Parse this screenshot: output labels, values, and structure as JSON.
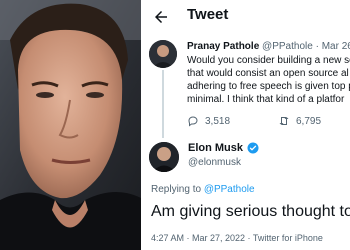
{
  "header": {
    "title": "Tweet"
  },
  "reply_tweet": {
    "author_name": "Pranay Pathole",
    "author_handle": "@PPathole",
    "separator": "·",
    "date": "Mar 26",
    "body_lines": [
      "Would you consider building a new so",
      "that would consist an open source al",
      "adhering to free speech is given top p",
      "minimal. I think that kind of a platfor"
    ],
    "stats": {
      "replies": "3,518",
      "retweets": "6,795"
    }
  },
  "main_tweet": {
    "author_name": "Elon Musk",
    "author_handle": "@elonmusk",
    "replying_prefix": "Replying to",
    "replying_handle": "@PPathole",
    "text": "Am giving serious thought to t",
    "timestamp": "4:27 AM · Mar 27, 2022 · Twitter for iPhone"
  },
  "icons": {
    "back": "back-arrow-icon",
    "reply": "reply-icon",
    "retweet": "retweet-icon",
    "verified": "verified-badge-icon"
  },
  "colors": {
    "accent": "#1d9bf0",
    "text": "#0f1419",
    "muted": "#536471"
  }
}
